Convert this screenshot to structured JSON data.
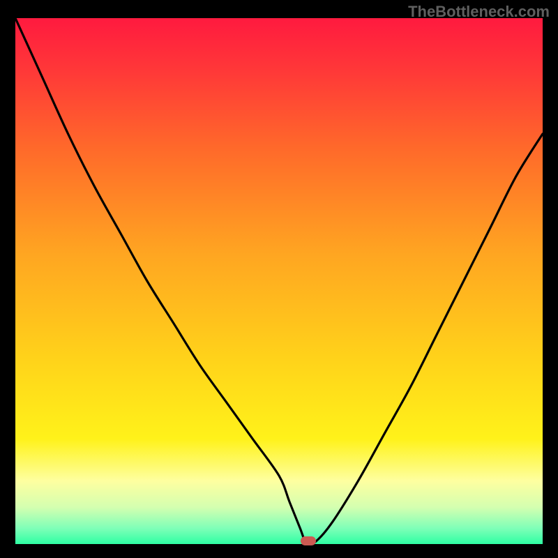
{
  "watermark": "TheBottleneck.com",
  "chart_data": {
    "type": "line",
    "title": "",
    "xlabel": "",
    "ylabel": "",
    "xlim": [
      0,
      100
    ],
    "ylim": [
      0,
      100
    ],
    "grid": false,
    "legend": false,
    "x": [
      0,
      5,
      10,
      15,
      20,
      25,
      30,
      35,
      40,
      45,
      50,
      52,
      54,
      55,
      56,
      57,
      60,
      65,
      70,
      75,
      80,
      85,
      90,
      95,
      100
    ],
    "y": [
      100,
      89,
      78,
      68,
      59,
      50,
      42,
      34,
      27,
      20,
      13,
      8,
      3,
      0.5,
      0.5,
      0.5,
      4,
      12,
      21,
      30,
      40,
      50,
      60,
      70,
      78
    ],
    "marker": {
      "x": 55.5,
      "y": 0.6
    },
    "background_gradient": {
      "stops": [
        {
          "offset": 0.0,
          "color": "#ff1a3f"
        },
        {
          "offset": 0.1,
          "color": "#ff3838"
        },
        {
          "offset": 0.25,
          "color": "#ff6a2a"
        },
        {
          "offset": 0.45,
          "color": "#ffa621"
        },
        {
          "offset": 0.65,
          "color": "#ffd31a"
        },
        {
          "offset": 0.8,
          "color": "#fff21a"
        },
        {
          "offset": 0.88,
          "color": "#feffa0"
        },
        {
          "offset": 0.93,
          "color": "#d4ffb0"
        },
        {
          "offset": 0.97,
          "color": "#7fffb8"
        },
        {
          "offset": 1.0,
          "color": "#2effa3"
        }
      ]
    }
  }
}
